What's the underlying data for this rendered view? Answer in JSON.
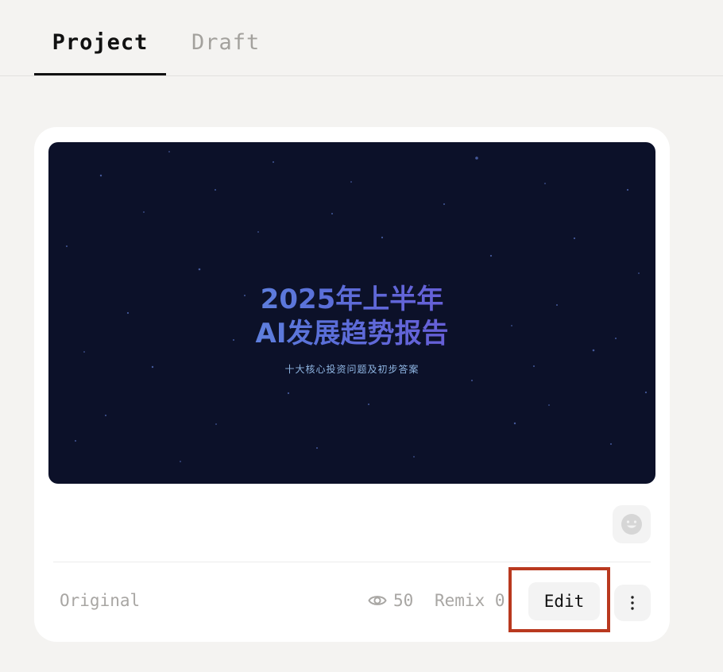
{
  "tabs": [
    {
      "label": "Project",
      "active": true
    },
    {
      "label": "Draft",
      "active": false
    }
  ],
  "card": {
    "thumbnail": {
      "title_line1": "2025年上半年",
      "title_line2": "AI发展趋势报告",
      "subtitle": "十大核心投资问题及初步答案",
      "background_color": "#0c1129"
    },
    "reaction_icon": "smiley-icon",
    "footer": {
      "label": "Original",
      "views_icon": "eye-icon",
      "views_count": "50",
      "remix_label": "Remix 0",
      "edit_label": "Edit",
      "more_icon": "vertical-dots-icon"
    }
  },
  "colors": {
    "page_background": "#f4f3f1",
    "card_background": "#ffffff",
    "highlight_border": "#b9391f",
    "muted_text": "#a8a6a3"
  }
}
